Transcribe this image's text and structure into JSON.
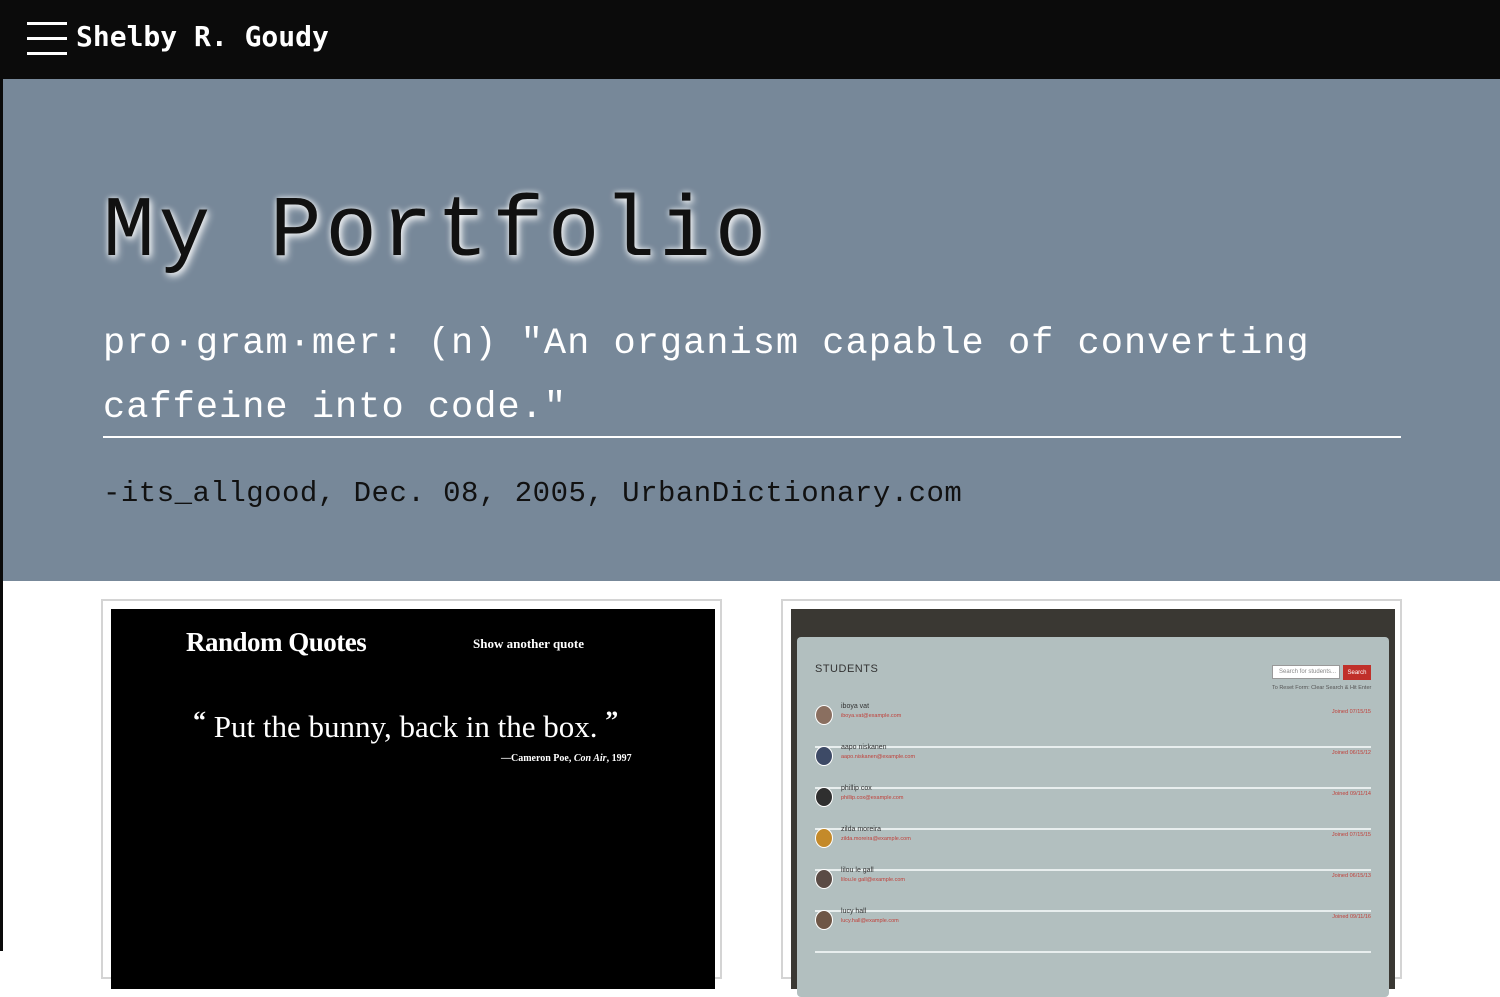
{
  "nav": {
    "site_name": "Shelby R. Goudy",
    "menu_icon": "hamburger-menu-icon"
  },
  "hero": {
    "title": "My Portfolio",
    "quote": "pro·gram·mer: (n) \"An organism capable of converting caffeine into code.\"",
    "citation": "-its_allgood, Dec. 08, 2005, UrbanDictionary.com"
  },
  "projects": [
    {
      "app_title": "Random Quotes",
      "button_label": "Show another quote",
      "quote_open": "“",
      "quote_text": "Put the bunny, back in the box.",
      "quote_close": "”",
      "citation_prefix": "—Cameron Poe, ",
      "citation_source": "Con Air",
      "citation_year": ", 1997"
    },
    {
      "app_title": "STUDENTS",
      "search_placeholder": "Search for students...",
      "search_button": "Search",
      "hint": "To Reset Form: Clear Search & Hit Enter",
      "students": [
        {
          "name": "iboya vat",
          "email": "iboya.vat@example.com",
          "joined": "Joined 07/15/15"
        },
        {
          "name": "aapo niskanen",
          "email": "aapo.niskanen@example.com",
          "joined": "Joined 06/15/12"
        },
        {
          "name": "phillip cox",
          "email": "phillip.cox@example.com",
          "joined": "Joined 09/11/14"
        },
        {
          "name": "zilda moreira",
          "email": "zilda.moreira@example.com",
          "joined": "Joined 07/15/15"
        },
        {
          "name": "lilou le gall",
          "email": "lilou.le gall@example.com",
          "joined": "Joined 06/15/13"
        },
        {
          "name": "lucy hall",
          "email": "lucy.hall@example.com",
          "joined": "Joined 09/11/16"
        }
      ]
    }
  ],
  "colors": {
    "nav_bg": "#0b0b0b",
    "hero_bg": "#778899",
    "accent_red": "#c0302a"
  }
}
